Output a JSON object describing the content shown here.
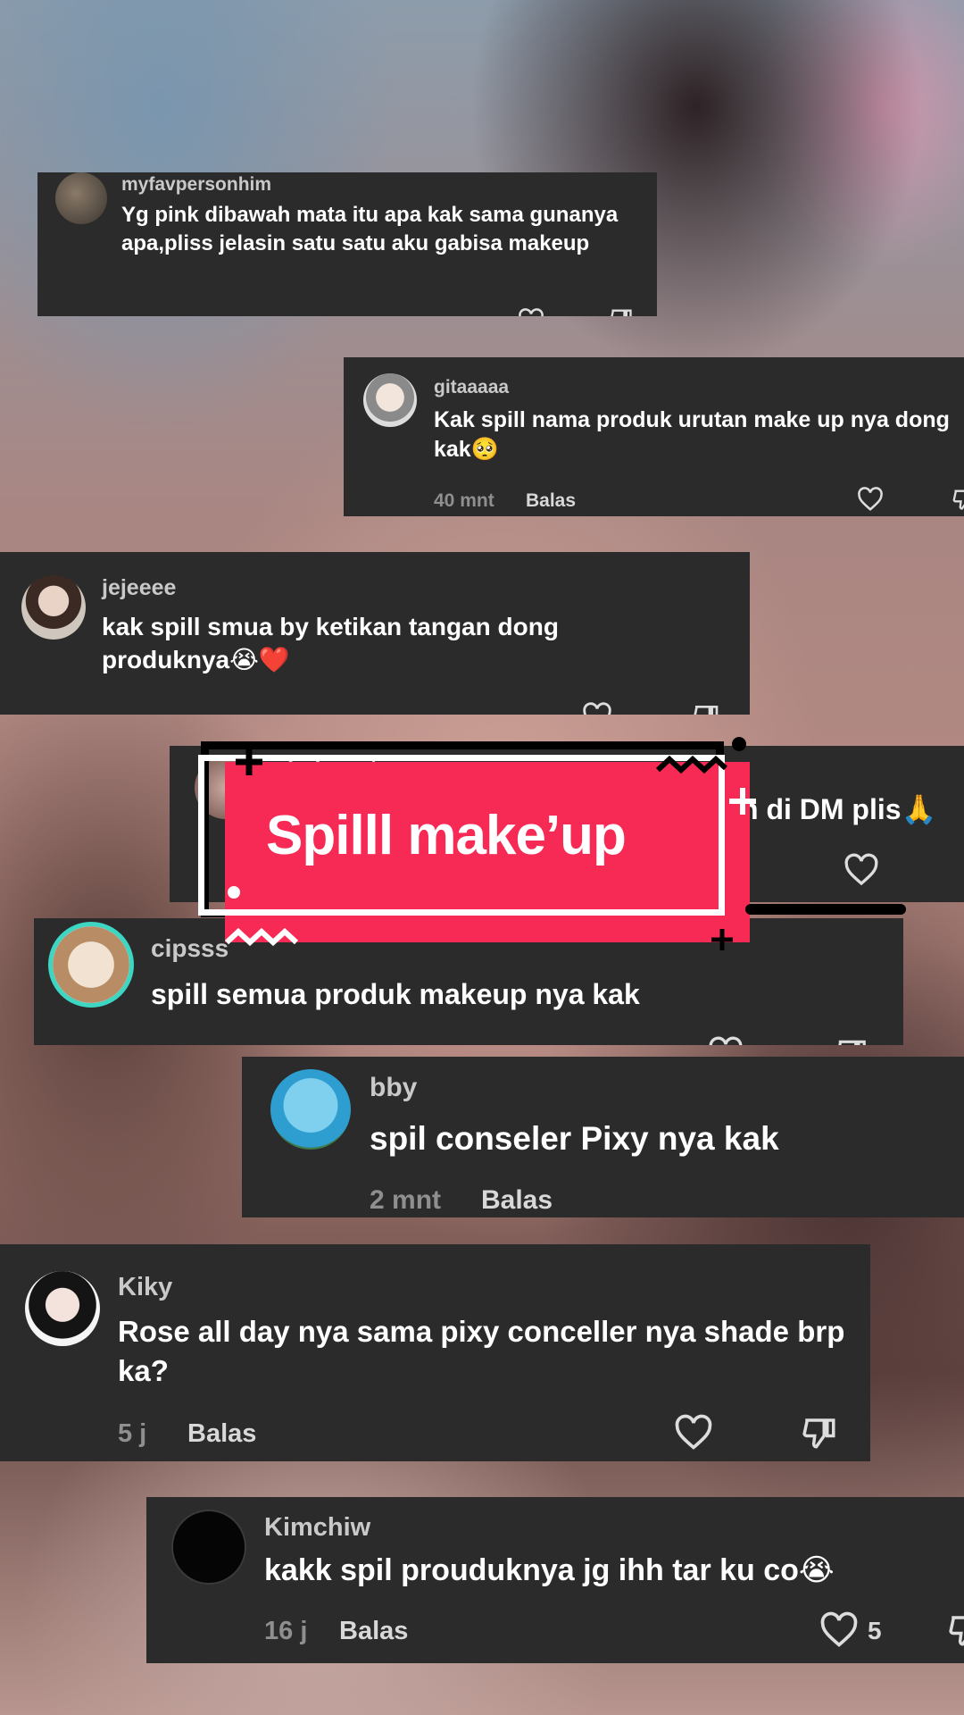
{
  "sticker": {
    "label": "Spilll make’up"
  },
  "comments": [
    {
      "username": "myfavpersonhim",
      "text": "Yg pink dibawah mata itu apa kak sama gunanya apa,pliss jelasin satu satu aku gabisa makeup"
    },
    {
      "username": "gitaaaaa",
      "text": "Kak spill nama produk urutan make up nya dong kak🥺",
      "time": "40 mnt",
      "reply": "Balas"
    },
    {
      "username": "jejeeee",
      "text": "kak spill smua by ketikan tangan dong produknya😭❤️"
    },
    {
      "username": "bebeputri",
      "text": "n di DM plis🙏"
    },
    {
      "username": "cipsss",
      "text": "spill semua produk makeup nya kak"
    },
    {
      "username": "bby",
      "text": "spil conseler Pixy nya kak",
      "time": "2 mnt",
      "reply": "Balas"
    },
    {
      "username": "Kiky",
      "text": "Rose all day nya sama pixy conceller nya shade brp ka?",
      "time": "5 j",
      "reply": "Balas"
    },
    {
      "username": "Kimchiw",
      "text": "kakk spil prouduknya jg ihh tar ku co😭",
      "time": "16 j",
      "reply": "Balas",
      "likes": "5"
    }
  ],
  "icons": [
    "heart-icon",
    "dislike-icon",
    "plus-icon",
    "zigzag-icon"
  ],
  "colors": {
    "card": "#2b2b2b",
    "sticker": "#f62a55",
    "avatar_ring": "#3dd6c3"
  }
}
